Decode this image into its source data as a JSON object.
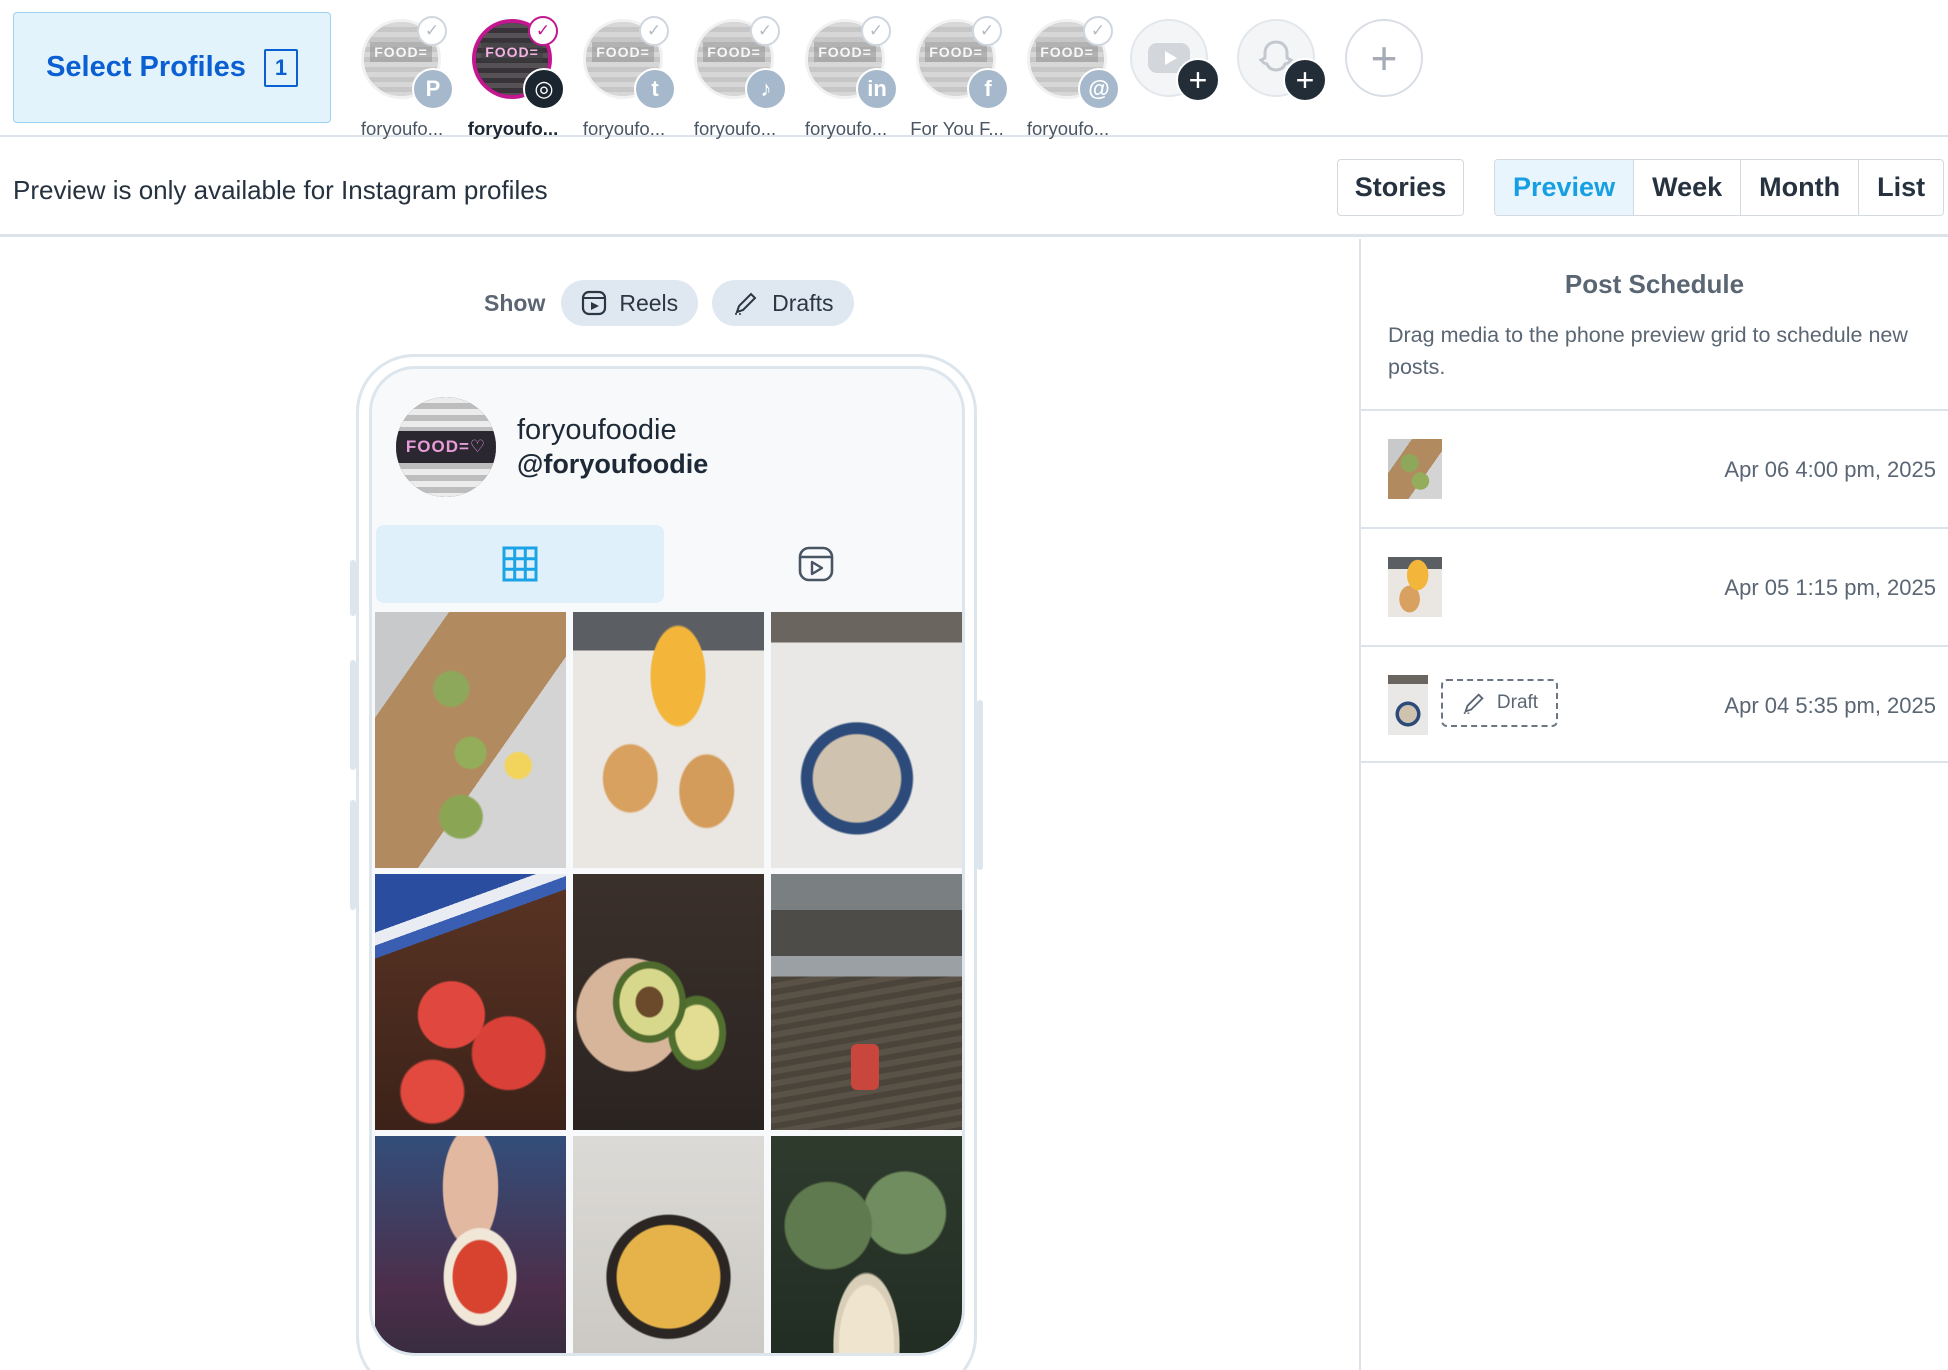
{
  "profile_bar": {
    "select_label": "Select Profiles",
    "select_count": "1",
    "profiles": [
      {
        "name": "foryoufo...",
        "network": "pinterest",
        "network_glyph": "P",
        "sign": "FOOD=",
        "active": false
      },
      {
        "name": "foryoufo...",
        "network": "instagram",
        "network_glyph": "◎",
        "sign": "FOOD=",
        "active": true
      },
      {
        "name": "foryoufo...",
        "network": "twitter",
        "network_glyph": "t",
        "sign": "FOOD=",
        "active": false
      },
      {
        "name": "foryoufo...",
        "network": "tiktok",
        "network_glyph": "♪",
        "sign": "FOOD=",
        "active": false
      },
      {
        "name": "foryoufo...",
        "network": "linkedin",
        "network_glyph": "in",
        "sign": "FOOD=",
        "active": false
      },
      {
        "name": "For You F...",
        "network": "facebook",
        "network_glyph": "f",
        "sign": "FOOD=",
        "active": false
      },
      {
        "name": "foryoufo...",
        "network": "threads",
        "network_glyph": "@",
        "sign": "FOOD=",
        "active": false
      }
    ],
    "add_youtube_icon": "youtube-icon",
    "add_snapchat_icon": "snapchat-icon",
    "add_glyph": "+"
  },
  "toolbar": {
    "notice": "Preview is only available for Instagram profiles",
    "stories_label": "Stories",
    "views": [
      "Preview",
      "Week",
      "Month",
      "List"
    ],
    "active_view": "Preview"
  },
  "filters": {
    "show_label": "Show",
    "reels_label": "Reels",
    "drafts_label": "Drafts"
  },
  "phone": {
    "display_name": "foryoufoodie",
    "handle": "@foryoufoodie",
    "avatar_sign": "FOOD=♡",
    "active_tab": "grid",
    "tiles": [
      {
        "subject": "avocado toast with lemons"
      },
      {
        "subject": "toast slices with dip bowl"
      },
      {
        "subject": "yogurt bowl with blueberries"
      },
      {
        "subject": "watermelon slices"
      },
      {
        "subject": "halved avocado in hand"
      },
      {
        "subject": "food pins on wooden dock"
      },
      {
        "subject": "hot sauce bottle"
      },
      {
        "subject": "cheesy skillet frittata"
      },
      {
        "subject": "citrus cocktail with plant"
      }
    ]
  },
  "post_schedule": {
    "title": "Post Schedule",
    "description": "Drag media to the phone preview grid to schedule new posts.",
    "items": [
      {
        "time": "Apr 06 4:00 pm, 2025",
        "draft": false
      },
      {
        "time": "Apr 05 1:15 pm, 2025",
        "draft": false
      },
      {
        "time": "Apr 04 5:35 pm, 2025",
        "draft": true,
        "draft_label": "Draft"
      }
    ]
  },
  "colors": {
    "accent": "#16a0e3",
    "select_blue": "#0a5fd3",
    "instagram_ring": "#c2178f",
    "border": "#dde3ea"
  }
}
